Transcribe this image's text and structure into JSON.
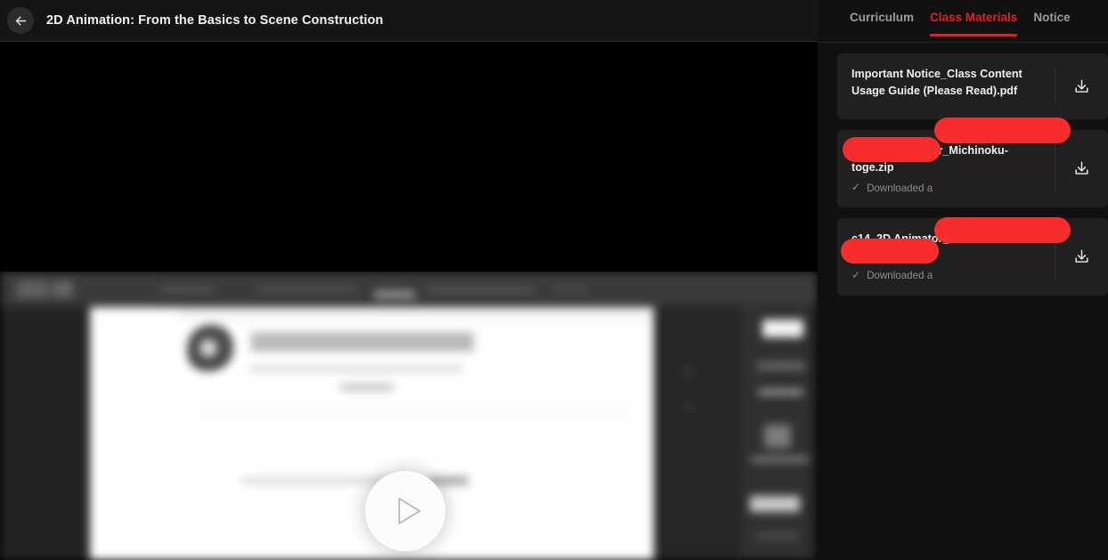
{
  "header": {
    "back_icon": "arrow-left-icon",
    "course_title": "2D Animation: From the Basics to Scene Construction"
  },
  "player": {
    "play_icon": "play-triangle-icon",
    "state": "paused",
    "thumbnail_description": "blurred screencast of animation software"
  },
  "sidebar": {
    "tabs": [
      {
        "label": "Curriculum",
        "active": false
      },
      {
        "label": "Class Materials",
        "active": true
      },
      {
        "label": "Notice",
        "active": false
      }
    ],
    "accent_color": "#e01f26",
    "redaction_color": "#f72c2c",
    "materials": [
      {
        "name": "Important Notice_Class Content Usage Guide (Please Read).pdf",
        "status": "",
        "check": "",
        "download_icon": "download-icon",
        "redacted": false
      },
      {
        "name": "c03_2D Animator_Michinoku-toge.zip",
        "status": "Downloaded a",
        "check": "✓",
        "download_icon": "download-icon",
        "redacted": true
      },
      {
        "name": "c14_2D Animator_Michinoku-toge.zip",
        "status": "Downloaded a",
        "check": "✓",
        "download_icon": "download-icon",
        "redacted": true
      }
    ]
  }
}
